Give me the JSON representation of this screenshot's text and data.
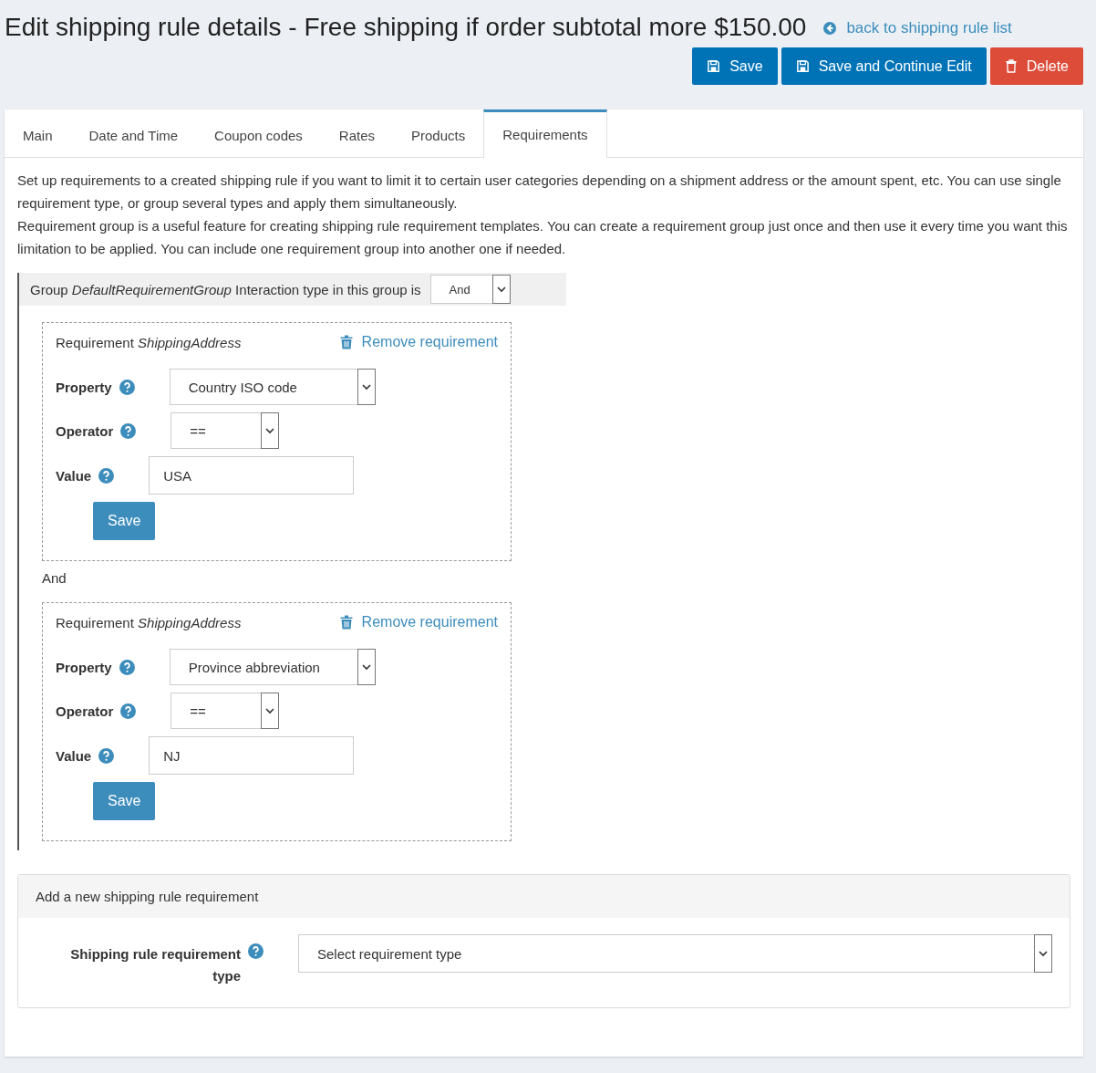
{
  "page": {
    "title": "Edit shipping rule details - Free shipping if order subtotal more $150.00",
    "back_link": "back to shipping rule list"
  },
  "actions": [
    {
      "label": "Save",
      "kind": "primary"
    },
    {
      "label": "Save and Continue Edit",
      "kind": "primary"
    },
    {
      "label": "Delete",
      "kind": "danger"
    }
  ],
  "tabs": [
    {
      "label": "Main",
      "selected": false
    },
    {
      "label": "Date and Time",
      "selected": false
    },
    {
      "label": "Coupon codes",
      "selected": false
    },
    {
      "label": "Rates",
      "selected": false
    },
    {
      "label": "Products",
      "selected": false
    },
    {
      "label": "Requirements",
      "selected": true
    }
  ],
  "description": [
    "Set up requirements to a created shipping rule if you want to limit it to certain user categories depending on a shipment address or the amount spent, etc. You can use single requirement type, or group several types and apply them simultaneously.",
    "Requirement group is a useful feature for creating shipping rule requirement templates. You can create a requirement group just once and then use it every time you want this limitation to be applied. You can include one requirement group into another one if needed."
  ],
  "group": {
    "header": "Group *DefaultRequirementGroup*  Interaction type in this group is",
    "interaction_type": "And",
    "requirements": [
      {
        "title": "Requirement *ShippingAddress*",
        "remove_link": "Remove requirement",
        "fields": [
          {
            "label": "Property",
            "kind": "select",
            "value": "Country ISO code"
          },
          {
            "label": "Operator",
            "kind": "operator",
            "value": "=="
          },
          {
            "label": "Value",
            "kind": "input",
            "value": "USA"
          }
        ],
        "save": "Save"
      },
      {
        "title": "Requirement *ShippingAddress*",
        "remove_link": "Remove requirement",
        "fields": [
          {
            "label": "Property",
            "kind": "select",
            "value": "Province abbreviation"
          },
          {
            "label": "Operator",
            "kind": "operator",
            "value": "=="
          },
          {
            "label": "Value",
            "kind": "input",
            "value": "NJ"
          }
        ],
        "save": "Save"
      }
    ],
    "separator": "And"
  },
  "add_panel": {
    "heading": "Add a new shipping rule requirement",
    "label": "Shipping rule requirement type",
    "placeholder": "Select requirement type"
  }
}
